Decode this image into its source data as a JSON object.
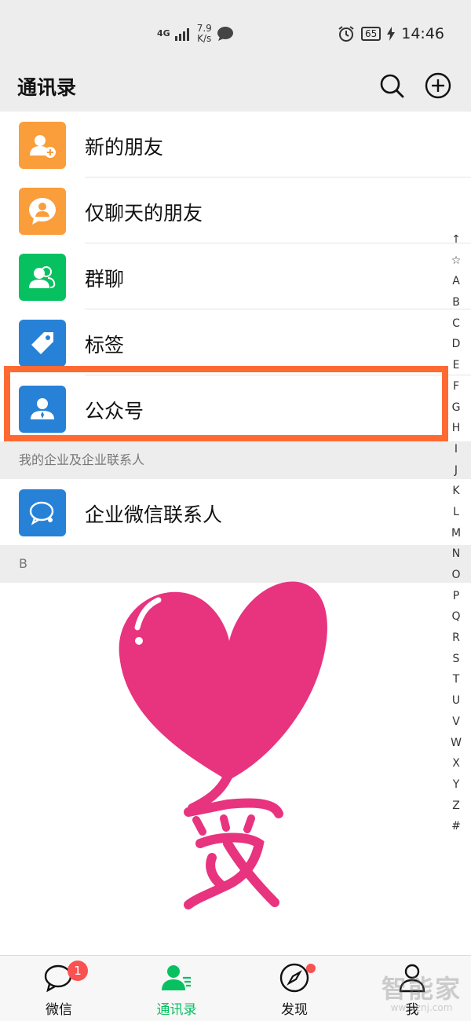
{
  "status_bar": {
    "network": "4G",
    "speed_value": "7.9",
    "speed_unit": "K/s",
    "battery": "65",
    "time": "14:46"
  },
  "header": {
    "title": "通讯录",
    "icons": [
      "search-icon",
      "add-icon"
    ]
  },
  "menu": [
    {
      "label": "新的朋友",
      "color": "#fa9d3b",
      "icon": "add-friend-icon"
    },
    {
      "label": "仅聊天的朋友",
      "color": "#fa9d3b",
      "icon": "chat-only-friend-icon"
    },
    {
      "label": "群聊",
      "color": "#07c160",
      "icon": "group-chat-icon"
    },
    {
      "label": "标签",
      "color": "#2782d7",
      "icon": "tag-icon"
    },
    {
      "label": "公众号",
      "color": "#2782d7",
      "icon": "official-account-icon"
    }
  ],
  "enterprise_section": {
    "header": "我的企业及企业联系人",
    "item": {
      "label": "企业微信联系人",
      "color": "#2782d7",
      "icon": "wecom-contacts-icon"
    }
  },
  "b_section": {
    "header": "B"
  },
  "index_letters": [
    "↑",
    "☆",
    "A",
    "B",
    "C",
    "D",
    "E",
    "F",
    "G",
    "H",
    "I",
    "J",
    "K",
    "L",
    "M",
    "N",
    "O",
    "P",
    "Q",
    "R",
    "S",
    "T",
    "U",
    "V",
    "W",
    "X",
    "Y",
    "Z",
    "#"
  ],
  "tabs": [
    {
      "label": "微信",
      "badge": "1",
      "icon": "chat-icon",
      "active": false
    },
    {
      "label": "通讯录",
      "icon": "contacts-icon",
      "active": true
    },
    {
      "label": "发现",
      "icon": "compass-icon",
      "active": false,
      "dot": true
    },
    {
      "label": "我",
      "icon": "me-icon",
      "active": false
    }
  ],
  "watermark": {
    "main": "智能家",
    "sub": "www.znj.com"
  },
  "colors": {
    "accent_green": "#07c160",
    "highlight": "#ff6a33",
    "heart": "#e8337f",
    "badge_red": "#fa5151"
  }
}
